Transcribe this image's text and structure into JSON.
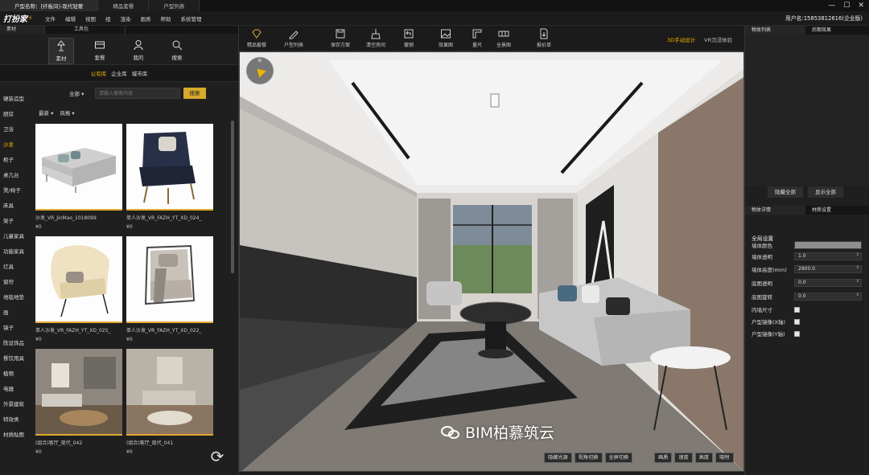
{
  "titlebar": {
    "tabs": [
      "户型名称：[纤板间]-现代轻奢",
      "精品套餐",
      "户型列表"
    ]
  },
  "menubar": {
    "logo": "打扮家",
    "items": [
      "文件",
      "编辑",
      "视图",
      "组",
      "渲染",
      "画质",
      "帮助",
      "系统管理"
    ],
    "username": "用户名:15853812616(企业版)"
  },
  "left_panel": {
    "tabs": [
      "素材",
      "工具包"
    ],
    "top_buttons": [
      {
        "label": "素材",
        "icon": "lamp-icon"
      },
      {
        "label": "套餐",
        "icon": "package-icon"
      },
      {
        "label": "我的",
        "icon": "user-icon"
      },
      {
        "label": "搜索",
        "icon": "search-icon"
      }
    ],
    "library_tabs": [
      "公有库",
      "企业库",
      "城市库"
    ],
    "categories": [
      "硬装造型",
      "厨房",
      "卫浴",
      "沙发",
      "柜子",
      "桌几台",
      "凳/椅子",
      "床具",
      "架子",
      "儿童家具",
      "功能家具",
      "灯具",
      "窗帘",
      "地毯地垫",
      "画",
      "镜子",
      "陈设饰品",
      "餐饮用具",
      "植物",
      "电器",
      "外景建筑",
      "特效类",
      "材质贴图"
    ],
    "active_category": "沙发",
    "search": {
      "scope": "全部",
      "placeholder": "请输入搜索内容",
      "button": "搜索"
    },
    "sort": [
      "最新",
      "风格"
    ],
    "products": [
      {
        "name": "沙发_VR_JinMao_1018099",
        "price": "¥0"
      },
      {
        "name": "单人沙发_VR_FAZH_YT_XD_024_",
        "price": "¥0"
      },
      {
        "name": "单人沙发_VR_FAZH_YT_XD_025_",
        "price": "¥0"
      },
      {
        "name": "单人沙发_VR_FAZH_YT_XD_022_",
        "price": "¥0"
      },
      {
        "name": "(组合)客厅_现代_042",
        "price": "¥0"
      },
      {
        "name": "(组合)客厅_现代_041",
        "price": "¥0"
      }
    ]
  },
  "toolbar": {
    "buttons": [
      "精品套餐",
      "户型列表",
      "保存方案",
      "清空房间",
      "撤销",
      "效果图",
      "量尺",
      "全景图",
      "报价单"
    ],
    "modes": [
      "3D手动设计",
      "VR沉浸体验"
    ]
  },
  "viewport": {
    "compass_label": "N",
    "buttons_left": [
      "隐藏光源",
      "视角切换",
      "全屏切换"
    ],
    "buttons_right": [
      "画质",
      "速度",
      "高度",
      "吸附"
    ],
    "watermark": "BIM柏慕筑云"
  },
  "right_panel": {
    "top_tabs": [
      "物体列表",
      "后期效果"
    ],
    "list_buttons": [
      "隐藏全部",
      "显示全部"
    ],
    "bottom_tabs": [
      "物体详情",
      "材质设置"
    ],
    "section_title": "全局设置",
    "props": [
      {
        "label": "墙体颜色",
        "type": "color",
        "value": ""
      },
      {
        "label": "墙体透明",
        "type": "input",
        "value": "1.0"
      },
      {
        "label": "墙体高度(mm)",
        "type": "input",
        "value": "2800.0"
      },
      {
        "label": "底图透明",
        "type": "input",
        "value": "0.0"
      },
      {
        "label": "底图旋转",
        "type": "input",
        "value": "0.0"
      },
      {
        "label": "内墙尺寸",
        "type": "checkbox",
        "value": ""
      },
      {
        "label": "户型镜像(X轴)",
        "type": "checkbox",
        "value": ""
      },
      {
        "label": "户型镜像(Y轴)",
        "type": "checkbox",
        "value": ""
      }
    ]
  },
  "colors": {
    "accent": "#f0b400",
    "panel": "#1f1f1f",
    "button_gold": "#d7a92c"
  }
}
